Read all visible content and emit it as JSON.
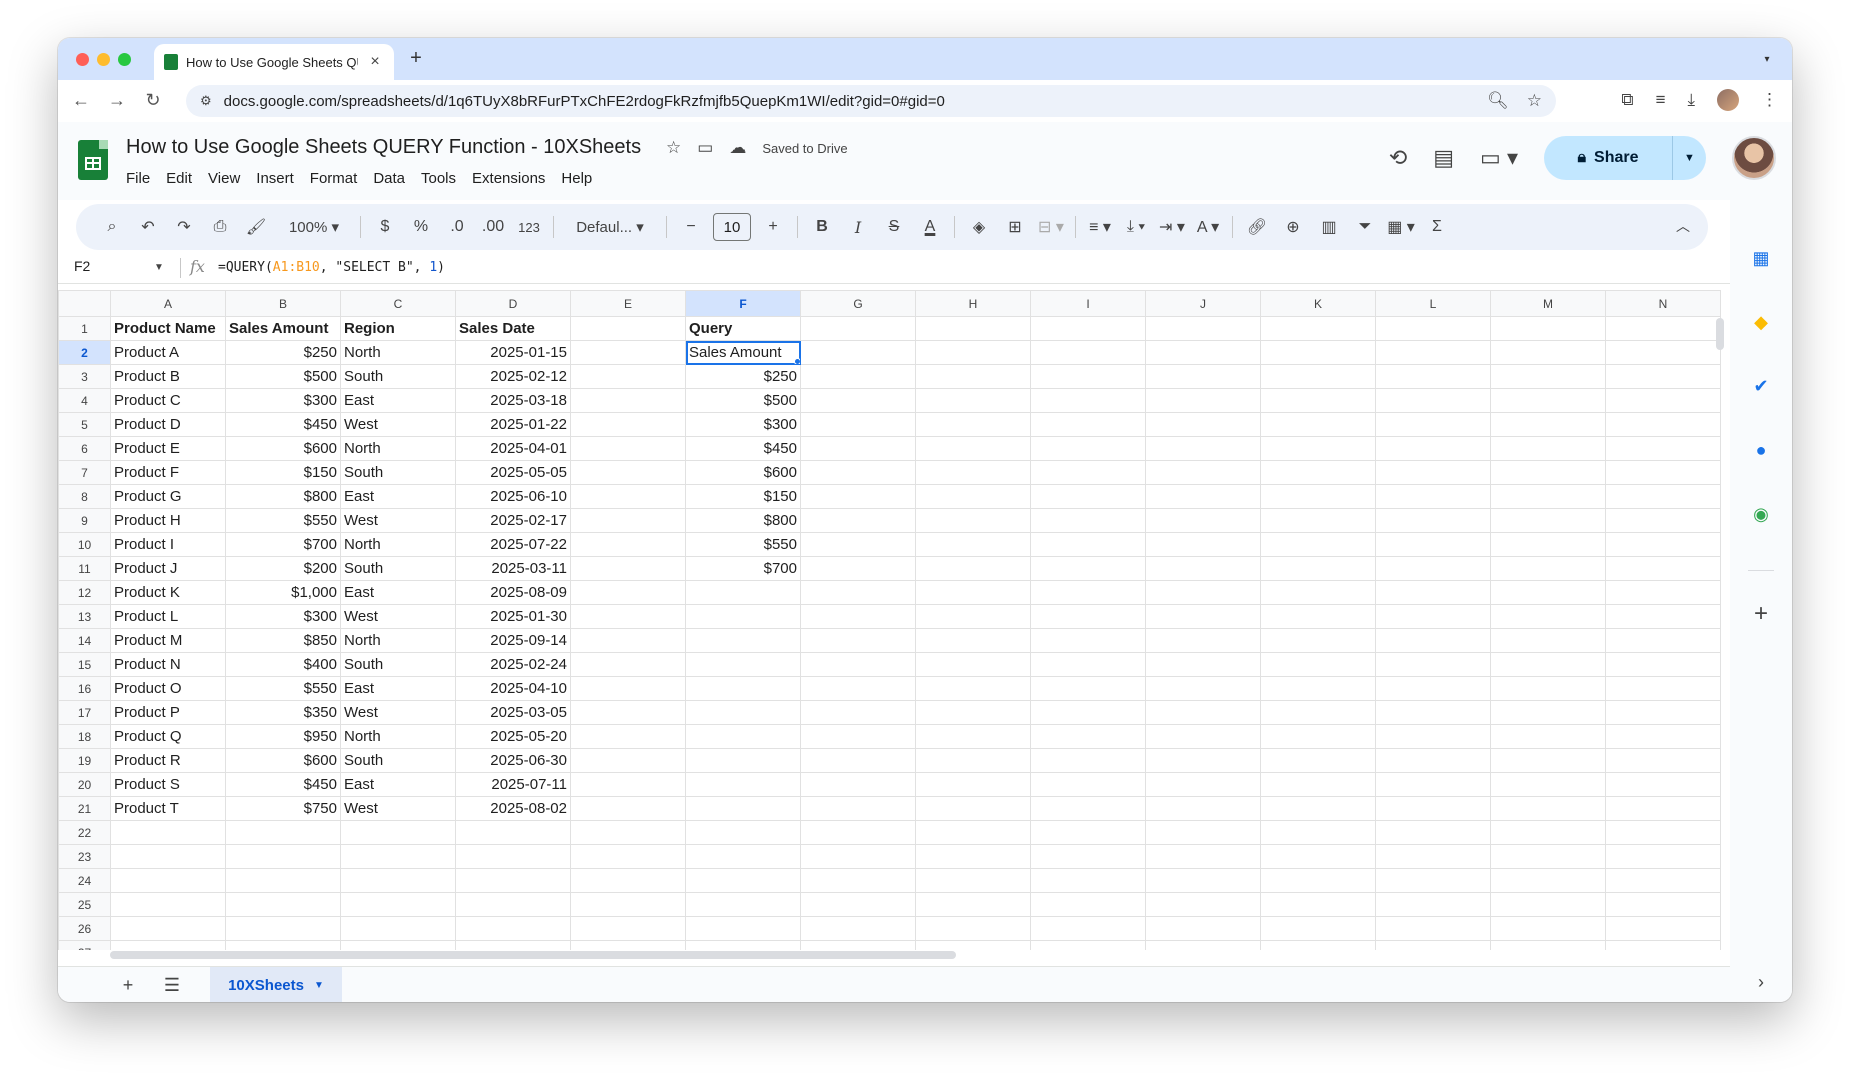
{
  "browser": {
    "tab_title": "How to Use Google Sheets QUERY Function - 10XSheets",
    "url": "docs.google.com/spreadsheets/d/1q6TUyX8bRFurPTxChFE2rdogFkRzfmjfb5QuepKm1WI/edit?gid=0#gid=0",
    "traffic_lights": [
      "#ff5f57",
      "#febc2e",
      "#28c840"
    ]
  },
  "app": {
    "title": "How to Use Google Sheets QUERY Function - 10XSheets",
    "saved_status": "Saved to Drive",
    "menu": [
      "File",
      "Edit",
      "View",
      "Insert",
      "Format",
      "Data",
      "Tools",
      "Extensions",
      "Help"
    ],
    "share_label": "Share",
    "accent": "#0b57d0"
  },
  "toolbar": {
    "zoom": "100%",
    "currency": "$",
    "percent": "%",
    "decrease_decimal": ".0",
    "increase_decimal": ".00",
    "number_format": "123",
    "font": "Defaul...",
    "font_size": "10",
    "bold": "B",
    "italic": "I",
    "text_color": "A",
    "sum": "Σ"
  },
  "formula_bar": {
    "cell_ref": "F2",
    "fx": "fx",
    "formula_prefix": "=QUERY(",
    "formula_range": "A1:B10",
    "formula_mid": ", \"SELECT B\", ",
    "formula_num": "1",
    "formula_suffix": ")"
  },
  "grid": {
    "columns": [
      "A",
      "B",
      "C",
      "D",
      "E",
      "F",
      "G",
      "H",
      "I",
      "J",
      "K",
      "L",
      "M",
      "N"
    ],
    "selected_column": "F",
    "selected_row": 2,
    "rows": [
      [
        "Product Name",
        "Sales Amount",
        "Region",
        "Sales Date",
        "",
        "Query"
      ],
      [
        "Product A",
        "$250",
        "North",
        "2025-01-15",
        "",
        "Sales Amount"
      ],
      [
        "Product B",
        "$500",
        "South",
        "2025-02-12",
        "",
        "$250"
      ],
      [
        "Product C",
        "$300",
        "East",
        "2025-03-18",
        "",
        "$500"
      ],
      [
        "Product D",
        "$450",
        "West",
        "2025-01-22",
        "",
        "$300"
      ],
      [
        "Product E",
        "$600",
        "North",
        "2025-04-01",
        "",
        "$450"
      ],
      [
        "Product F",
        "$150",
        "South",
        "2025-05-05",
        "",
        "$600"
      ],
      [
        "Product G",
        "$800",
        "East",
        "2025-06-10",
        "",
        "$150"
      ],
      [
        "Product H",
        "$550",
        "West",
        "2025-02-17",
        "",
        "$800"
      ],
      [
        "Product I",
        "$700",
        "North",
        "2025-07-22",
        "",
        "$550"
      ],
      [
        "Product J",
        "$200",
        "South",
        "2025-03-11",
        "",
        "$700"
      ],
      [
        "Product K",
        "$1,000",
        "East",
        "2025-08-09",
        "",
        ""
      ],
      [
        "Product L",
        "$300",
        "West",
        "2025-01-30",
        "",
        ""
      ],
      [
        "Product M",
        "$850",
        "North",
        "2025-09-14",
        "",
        ""
      ],
      [
        "Product N",
        "$400",
        "South",
        "2025-02-24",
        "",
        ""
      ],
      [
        "Product O",
        "$550",
        "East",
        "2025-04-10",
        "",
        ""
      ],
      [
        "Product P",
        "$350",
        "West",
        "2025-03-05",
        "",
        ""
      ],
      [
        "Product Q",
        "$950",
        "North",
        "2025-05-20",
        "",
        ""
      ],
      [
        "Product R",
        "$600",
        "South",
        "2025-06-30",
        "",
        ""
      ],
      [
        "Product S",
        "$450",
        "East",
        "2025-07-11",
        "",
        ""
      ],
      [
        "Product T",
        "$750",
        "West",
        "2025-08-02",
        "",
        ""
      ],
      [
        "",
        "",
        "",
        "",
        "",
        ""
      ],
      [
        "",
        "",
        "",
        "",
        "",
        ""
      ],
      [
        "",
        "",
        "",
        "",
        "",
        ""
      ],
      [
        "",
        "",
        "",
        "",
        "",
        ""
      ],
      [
        "",
        "",
        "",
        "",
        "",
        ""
      ]
    ],
    "row_count_visible": 26,
    "partial_row_label": "27"
  },
  "sheets": {
    "active_tab": "10XSheets"
  }
}
